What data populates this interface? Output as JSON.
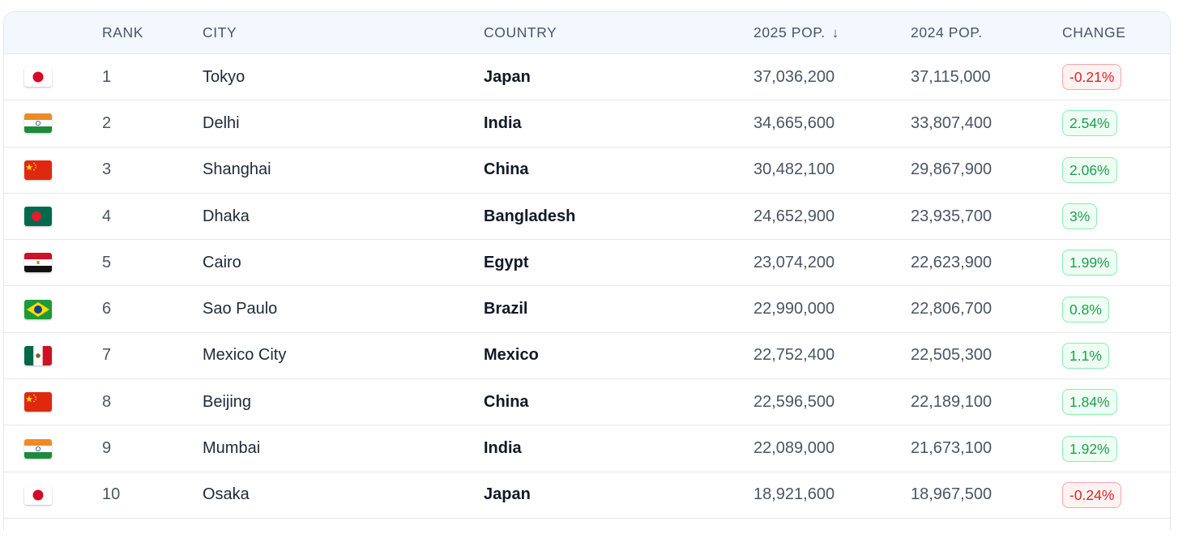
{
  "table": {
    "headers": {
      "flag": "",
      "rank": "RANK",
      "city": "CITY",
      "country": "COUNTRY",
      "pop_2025": "2025 POP.",
      "pop_2024": "2024 POP.",
      "change": "CHANGE"
    },
    "sort_indicator": "↓",
    "rows": [
      {
        "flag": "japan-flag-icon",
        "rank": "1",
        "city": "Tokyo",
        "country": "Japan",
        "pop_2025": "37,036,200",
        "pop_2024": "37,115,000",
        "change": "-0.21%",
        "trend": "down"
      },
      {
        "flag": "india-flag-icon",
        "rank": "2",
        "city": "Delhi",
        "country": "India",
        "pop_2025": "34,665,600",
        "pop_2024": "33,807,400",
        "change": "2.54%",
        "trend": "up"
      },
      {
        "flag": "china-flag-icon",
        "rank": "3",
        "city": "Shanghai",
        "country": "China",
        "pop_2025": "30,482,100",
        "pop_2024": "29,867,900",
        "change": "2.06%",
        "trend": "up"
      },
      {
        "flag": "bangladesh-flag-icon",
        "rank": "4",
        "city": "Dhaka",
        "country": "Bangladesh",
        "pop_2025": "24,652,900",
        "pop_2024": "23,935,700",
        "change": "3%",
        "trend": "up"
      },
      {
        "flag": "egypt-flag-icon",
        "rank": "5",
        "city": "Cairo",
        "country": "Egypt",
        "pop_2025": "23,074,200",
        "pop_2024": "22,623,900",
        "change": "1.99%",
        "trend": "up"
      },
      {
        "flag": "brazil-flag-icon",
        "rank": "6",
        "city": "Sao Paulo",
        "country": "Brazil",
        "pop_2025": "22,990,000",
        "pop_2024": "22,806,700",
        "change": "0.8%",
        "trend": "up"
      },
      {
        "flag": "mexico-flag-icon",
        "rank": "7",
        "city": "Mexico City",
        "country": "Mexico",
        "pop_2025": "22,752,400",
        "pop_2024": "22,505,300",
        "change": "1.1%",
        "trend": "up"
      },
      {
        "flag": "china-flag-icon",
        "rank": "8",
        "city": "Beijing",
        "country": "China",
        "pop_2025": "22,596,500",
        "pop_2024": "22,189,100",
        "change": "1.84%",
        "trend": "up"
      },
      {
        "flag": "india-flag-icon",
        "rank": "9",
        "city": "Mumbai",
        "country": "India",
        "pop_2025": "22,089,000",
        "pop_2024": "21,673,100",
        "change": "1.92%",
        "trend": "up"
      },
      {
        "flag": "japan-flag-icon",
        "rank": "10",
        "city": "Osaka",
        "country": "Japan",
        "pop_2025": "18,921,600",
        "pop_2024": "18,967,500",
        "change": "-0.24%",
        "trend": "down"
      }
    ]
  },
  "colors": {
    "header_bg": "#f3f8fe",
    "positive": "#16a34a",
    "negative": "#dc2626"
  }
}
